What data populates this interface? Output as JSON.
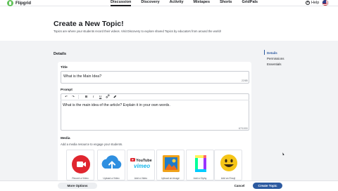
{
  "nav": {
    "logo_text": "Flipgrid",
    "tabs": [
      {
        "label": "Discussion",
        "active": true
      },
      {
        "label": "Discovery",
        "active": false
      },
      {
        "label": "Activity",
        "active": false
      },
      {
        "label": "Mixtapes",
        "active": false
      },
      {
        "label": "Shorts",
        "active": false
      },
      {
        "label": "GridPals",
        "active": false
      }
    ],
    "help_label": "Help"
  },
  "header": {
    "title": "Create a New Topic!",
    "subtitle": "Topics are where your students record their videos. Visit Discovery to explore shared Topics by educators from around the world!"
  },
  "details": {
    "section_title": "Details",
    "title_label": "Title",
    "title_value": "What is the Main Idea?",
    "title_count": "22/85",
    "prompt_label": "Prompt",
    "prompt_value": "What is the main idea of the article? Explain it in your own words.",
    "prompt_count": "67/1000",
    "toolbar": [
      "↶",
      "↷",
      "B",
      "I",
      "U",
      "🔗",
      "✎"
    ],
    "media_label": "Media",
    "media_hint": "Add a media resource to engage your students.",
    "media_options": [
      {
        "label": "Record a Video",
        "icon": "camera-icon",
        "color": "#e0262f"
      },
      {
        "label": "Upload a Video",
        "icon": "upload-icon",
        "color": "#2f8fe0"
      },
      {
        "label": "Add a Video",
        "icon": "youtube-vimeo-icon",
        "color": "#e0262f"
      },
      {
        "label": "Upload an Image",
        "icon": "image-icon",
        "color": "#f0a21a"
      },
      {
        "label": "Add a Giphy",
        "icon": "giphy-icon",
        "color": "#9b3df0"
      },
      {
        "label": "Add an Emoji",
        "icon": "emoji-icon",
        "color": "#f5c518"
      }
    ]
  },
  "side_nav": {
    "items": [
      {
        "label": "Details",
        "active": true
      },
      {
        "label": "Permissions",
        "active": false
      },
      {
        "label": "Essentials",
        "active": false
      }
    ]
  },
  "footer": {
    "more_options": "More Options",
    "cancel": "Cancel",
    "create": "Create Topic"
  },
  "colors": {
    "accent": "#2c5aa0",
    "brand_green": "#62c25a",
    "background": "#f2f3f5"
  }
}
